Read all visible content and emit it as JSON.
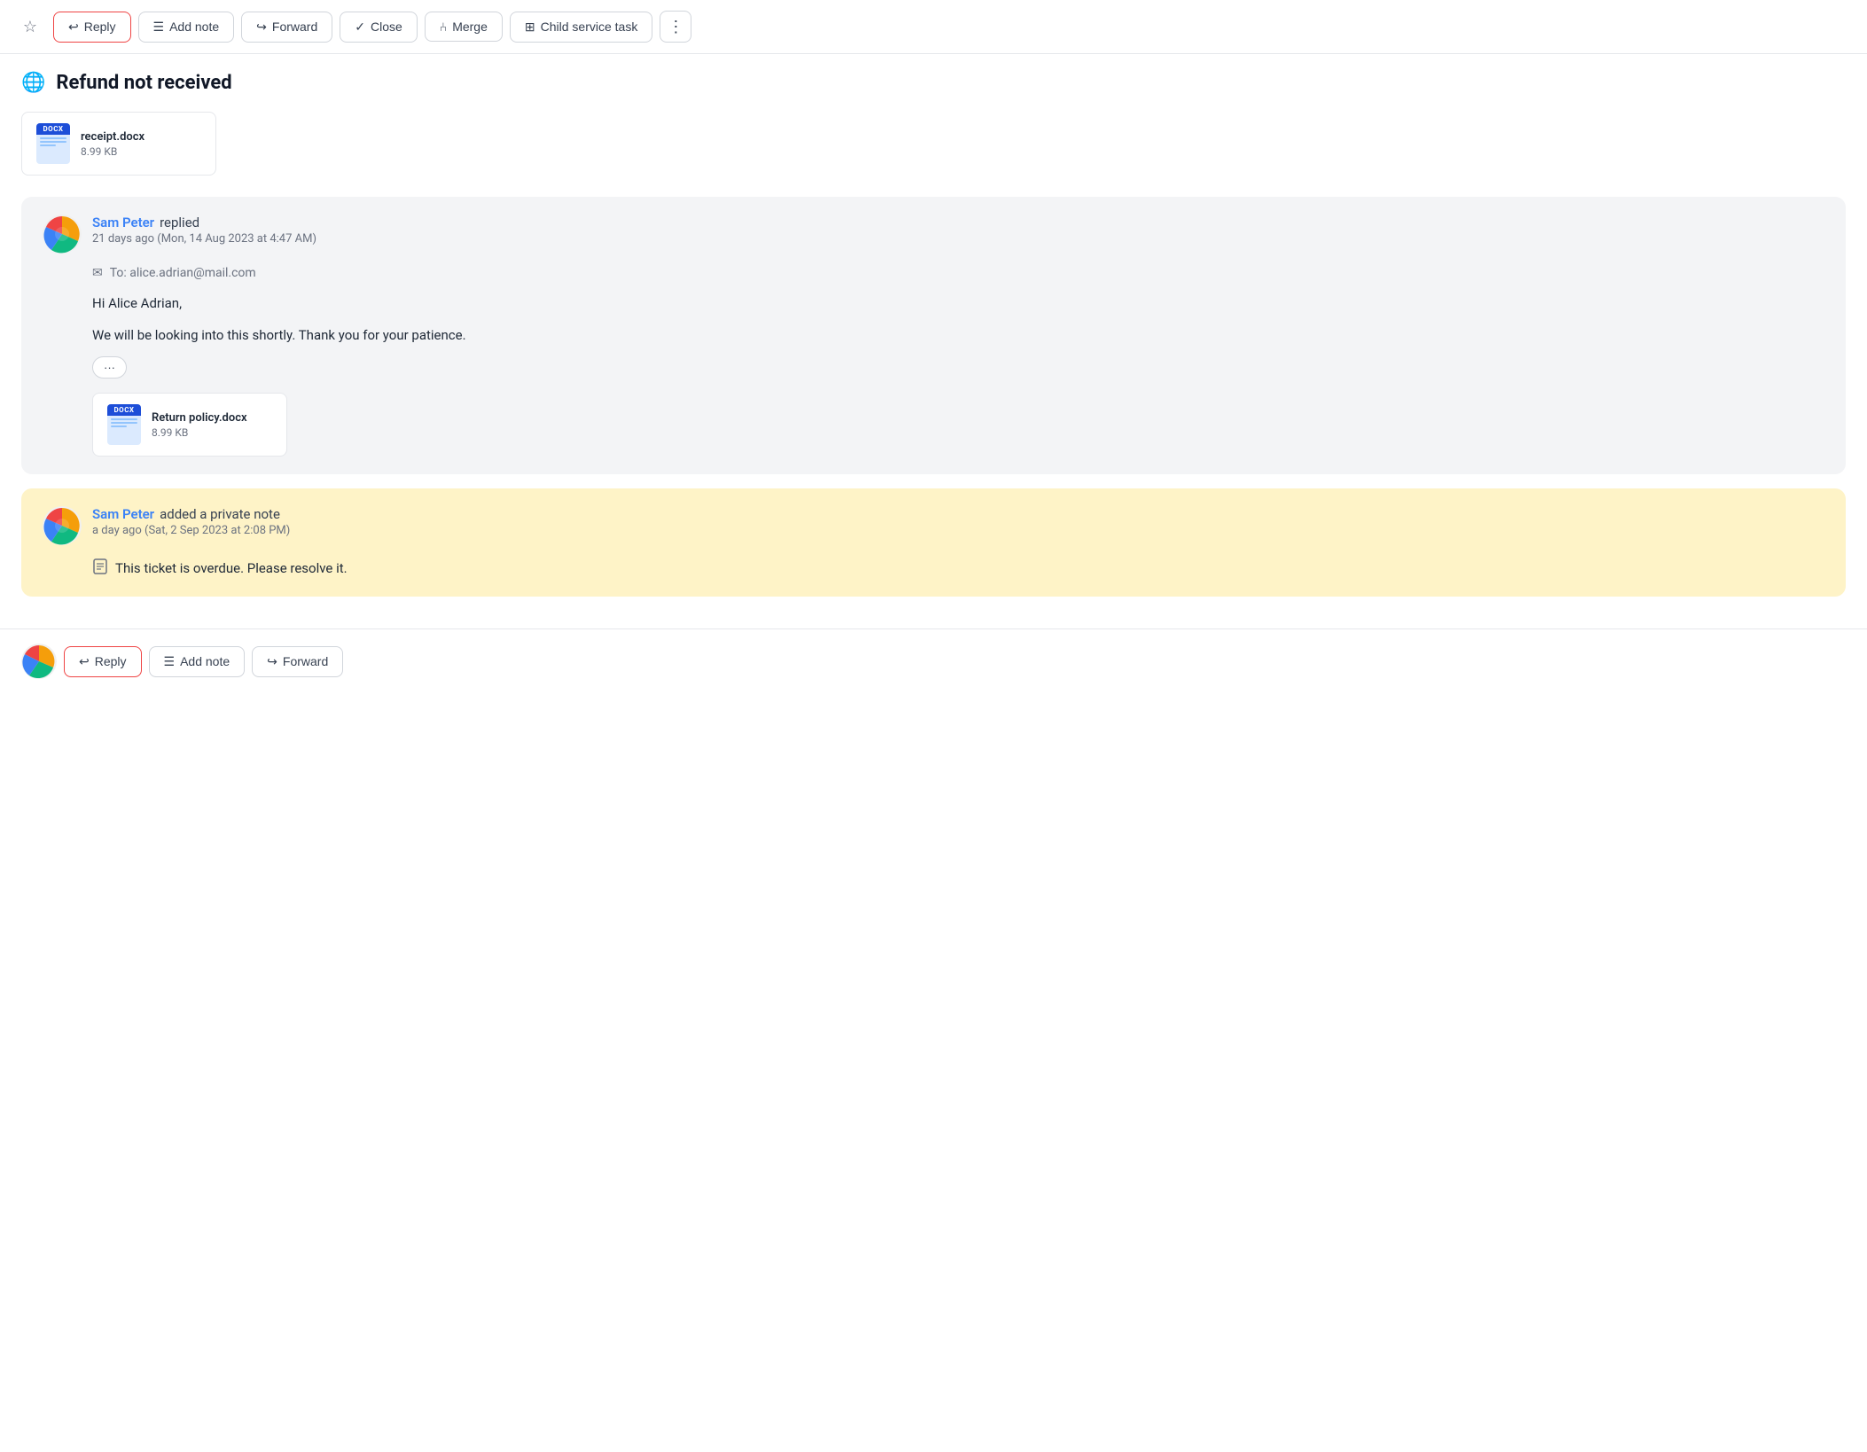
{
  "toolbar": {
    "star_label": "☆",
    "reply_label": "Reply",
    "add_note_label": "Add note",
    "forward_label": "Forward",
    "close_label": "Close",
    "merge_label": "Merge",
    "child_service_task_label": "Child service task",
    "more_label": "⋮"
  },
  "page": {
    "title": "Refund not received"
  },
  "attachments": [
    {
      "name": "receipt.docx",
      "size": "8.99 KB",
      "type": "DOCX"
    }
  ],
  "conversations": [
    {
      "id": "conv1",
      "sender": "Sam Peter",
      "action": "replied",
      "timestamp": "21 days ago (Mon, 14 Aug 2023 at 4:47 AM)",
      "to": "alice.adrian@mail.com",
      "body_lines": [
        "Hi Alice Adrian,",
        "We will be looking into this shortly. Thank you for your patience."
      ],
      "has_expand": true,
      "attachment": {
        "name": "Return policy.docx",
        "size": "8.99 KB",
        "type": "DOCX"
      },
      "type": "reply"
    },
    {
      "id": "conv2",
      "sender": "Sam Peter",
      "action": "added a private note",
      "timestamp": "a day ago (Sat, 2 Sep 2023 at 2:08 PM)",
      "note_text": "This ticket is overdue. Please resolve it.",
      "type": "private_note"
    }
  ],
  "bottom_toolbar": {
    "reply_label": "Reply",
    "add_note_label": "Add note",
    "forward_label": "Forward"
  },
  "icons": {
    "reply_arrow": "↩",
    "forward_arrow": "↪",
    "add_note": "☰",
    "close_check": "✓",
    "merge": "⑃",
    "child_task": "⊞",
    "globe": "🌐",
    "envelope": "✉",
    "expand_dots": "···",
    "note_pad": "📋",
    "star": "☆"
  }
}
